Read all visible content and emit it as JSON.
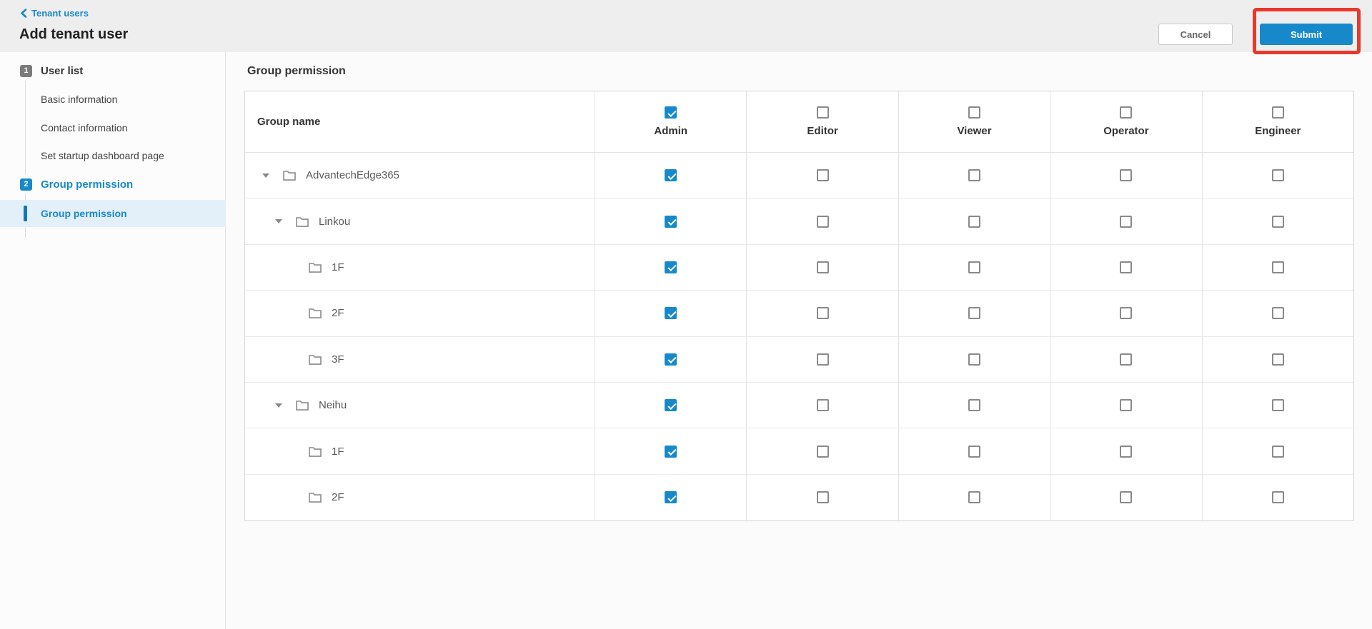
{
  "header": {
    "breadcrumb": "Tenant users",
    "title": "Add tenant user",
    "cancel_label": "Cancel",
    "submit_label": "Submit"
  },
  "colors": {
    "accent_blue": "#1789cb",
    "annotation_red": "#e8382c",
    "selected_item_bg": "#e3f0fa",
    "topbar_bg": "#eeeeee"
  },
  "sidebar": {
    "steps": [
      {
        "number": "1",
        "label": "User list",
        "active": false,
        "children": [
          {
            "label": "Basic information"
          },
          {
            "label": "Contact information"
          },
          {
            "label": "Set startup dashboard page"
          }
        ]
      },
      {
        "number": "2",
        "label": "Group permission",
        "active": true,
        "children": [
          {
            "label": "Group permission",
            "selected": true
          }
        ]
      }
    ]
  },
  "main": {
    "section_title": "Group permission",
    "table": {
      "name_header": "Group name",
      "columns": [
        {
          "label": "Admin",
          "checked": true
        },
        {
          "label": "Editor",
          "checked": false
        },
        {
          "label": "Viewer",
          "checked": false
        },
        {
          "label": "Operator",
          "checked": false
        },
        {
          "label": "Engineer",
          "checked": false
        }
      ],
      "rows": [
        {
          "name": "AdvantechEdge365",
          "level": 0,
          "expandable": true,
          "expanded": true,
          "admin": true,
          "editor": false,
          "viewer": false,
          "operator": false,
          "engineer": false
        },
        {
          "name": "Linkou",
          "level": 1,
          "expandable": true,
          "expanded": true,
          "admin": true,
          "editor": false,
          "viewer": false,
          "operator": false,
          "engineer": false
        },
        {
          "name": "1F",
          "level": 2,
          "expandable": false,
          "admin": true,
          "editor": false,
          "viewer": false,
          "operator": false,
          "engineer": false
        },
        {
          "name": "2F",
          "level": 2,
          "expandable": false,
          "admin": true,
          "editor": false,
          "viewer": false,
          "operator": false,
          "engineer": false
        },
        {
          "name": "3F",
          "level": 2,
          "expandable": false,
          "admin": true,
          "editor": false,
          "viewer": false,
          "operator": false,
          "engineer": false
        },
        {
          "name": "Neihu",
          "level": 1,
          "expandable": true,
          "expanded": true,
          "admin": true,
          "editor": false,
          "viewer": false,
          "operator": false,
          "engineer": false
        },
        {
          "name": "1F",
          "level": 2,
          "expandable": false,
          "admin": true,
          "editor": false,
          "viewer": false,
          "operator": false,
          "engineer": false
        },
        {
          "name": "2F",
          "level": 2,
          "expandable": false,
          "admin": true,
          "editor": false,
          "viewer": false,
          "operator": false,
          "engineer": false
        }
      ]
    }
  }
}
